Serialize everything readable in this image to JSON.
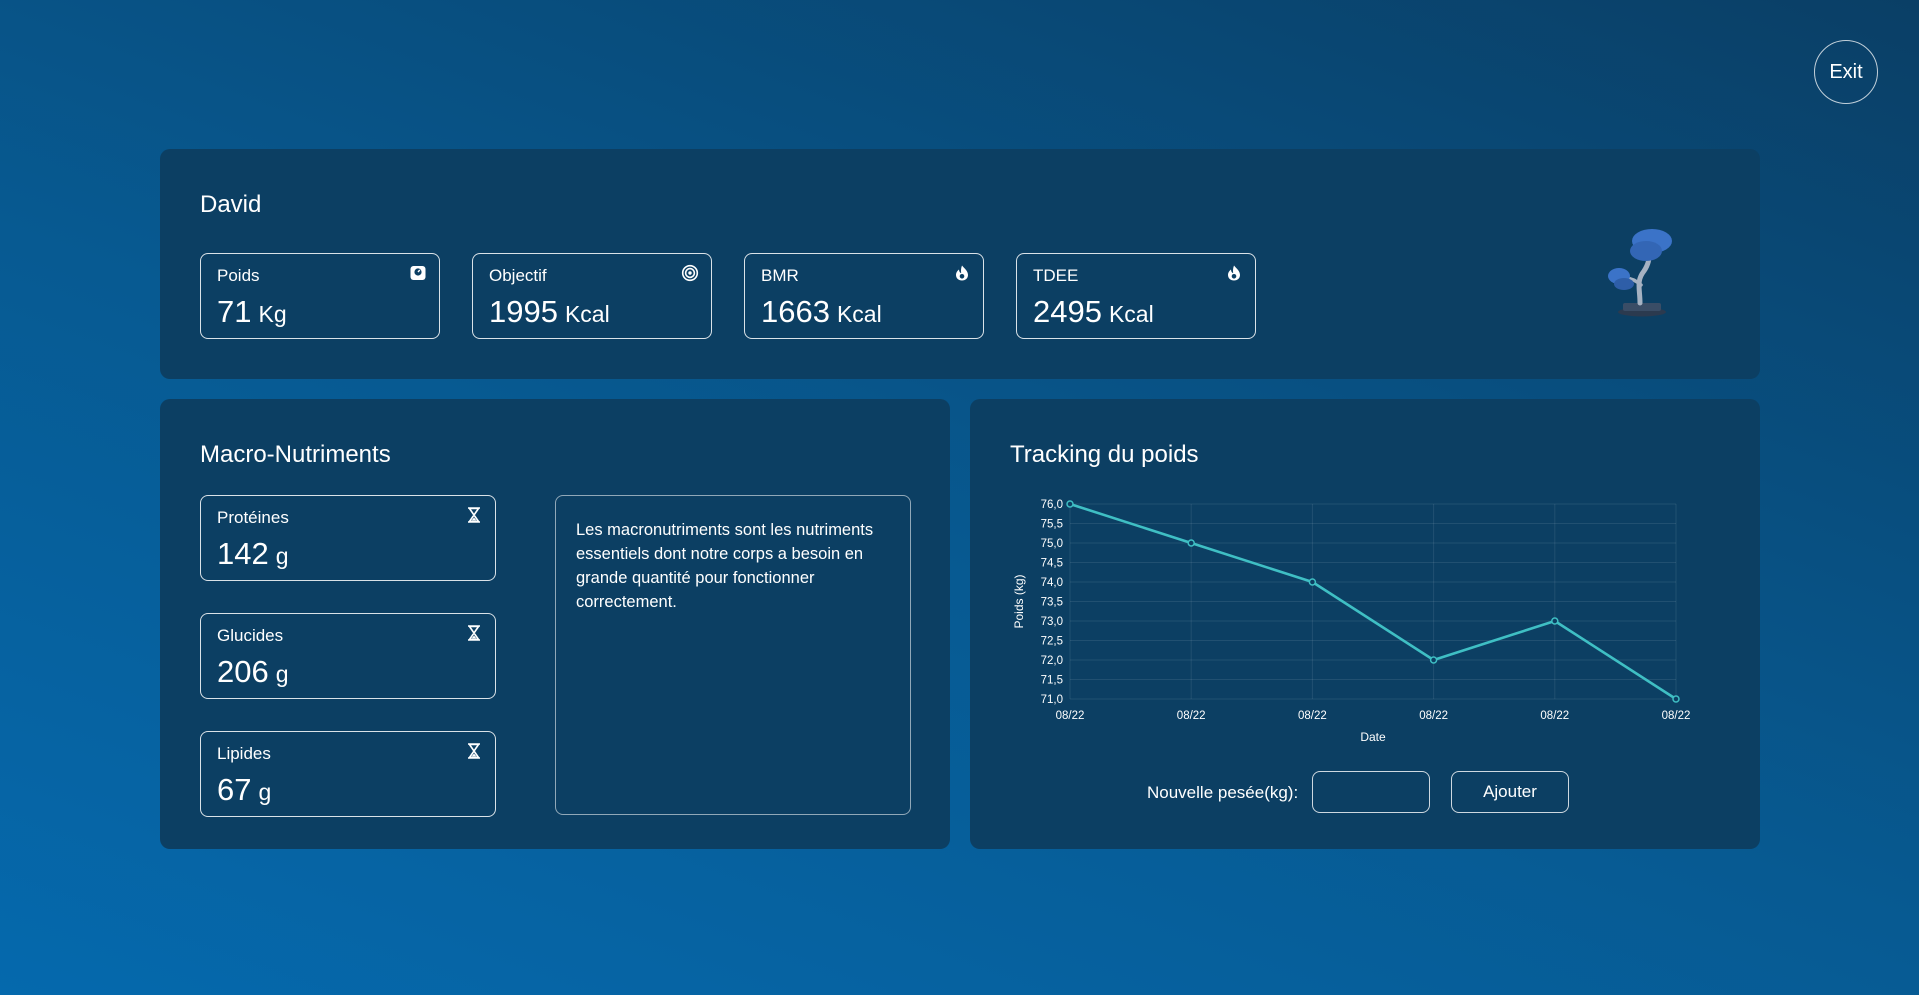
{
  "header": {
    "exit_label": "Exit"
  },
  "user": {
    "name": "David",
    "stats": [
      {
        "label": "Poids",
        "value": "71",
        "unit": "Kg",
        "icon": "scale-icon"
      },
      {
        "label": "Objectif",
        "value": "1995",
        "unit": "Kcal",
        "icon": "target-icon"
      },
      {
        "label": "BMR",
        "value": "1663",
        "unit": "Kcal",
        "icon": "flame-icon"
      },
      {
        "label": "TDEE",
        "value": "2495",
        "unit": "Kcal",
        "icon": "flame-icon"
      }
    ],
    "illustration": "bonsai-tree-icon"
  },
  "macros": {
    "title": "Macro-Nutriments",
    "items": [
      {
        "label": "Protéines",
        "value": "142",
        "unit": "g",
        "icon": "hourglass-icon"
      },
      {
        "label": "Glucides",
        "value": "206",
        "unit": "g",
        "icon": "hourglass-icon"
      },
      {
        "label": "Lipides",
        "value": "67",
        "unit": "g",
        "icon": "hourglass-icon"
      }
    ],
    "description": "Les macronutriments sont les nutriments essentiels dont notre corps a besoin en grande quantité pour fonctionner correctement."
  },
  "tracking": {
    "title": "Tracking du poids",
    "input_label": "Nouvelle pesée(kg):",
    "input_value": "",
    "input_placeholder": "",
    "add_label": "Ajouter"
  },
  "chart_data": {
    "type": "line",
    "title": "",
    "xlabel": "Date",
    "ylabel": "Poids (kg)",
    "categories": [
      "08/22",
      "08/22",
      "08/22",
      "08/22",
      "08/22",
      "08/22"
    ],
    "series": [
      {
        "values": [
          76.0,
          75.0,
          74.0,
          72.0,
          73.0,
          71.0
        ]
      }
    ],
    "ylim": [
      71.0,
      76.0
    ],
    "yticks": [
      "71,0",
      "71,5",
      "72,0",
      "72,5",
      "73,0",
      "73,5",
      "74,0",
      "74,5",
      "75,0",
      "75,5",
      "76,0"
    ],
    "grid": true,
    "legend": "none",
    "line_color": "#3fbfc4"
  },
  "colors": {
    "panel": "#0c3f63",
    "accent_line": "#3fbfc4",
    "plant_canopy": "#3b73c8",
    "plant_trunk": "#9aa7b8"
  }
}
